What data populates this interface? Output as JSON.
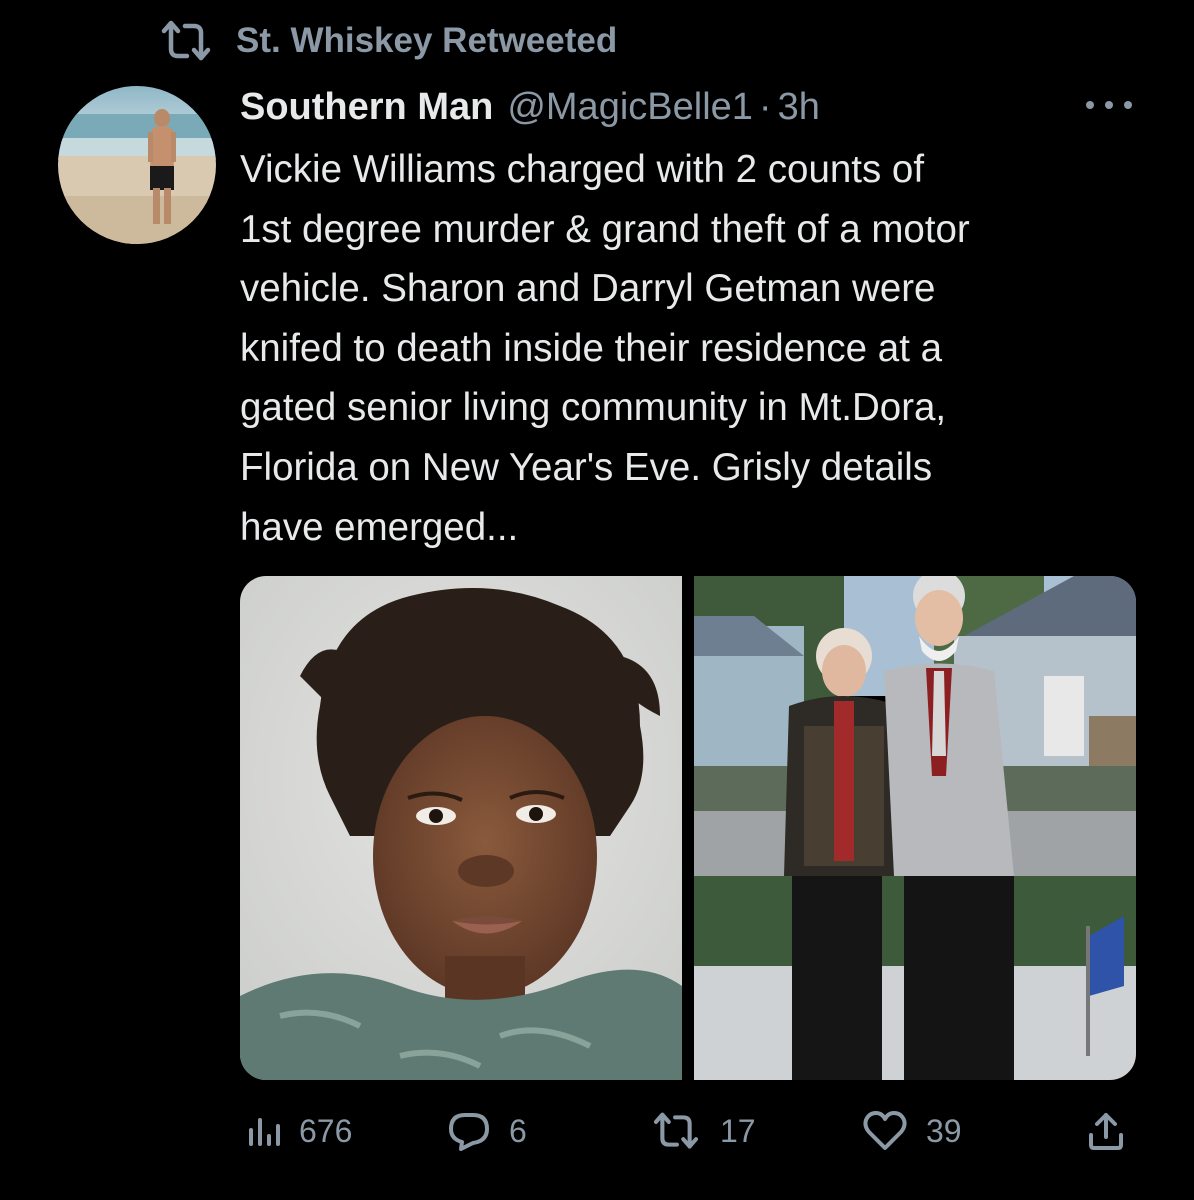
{
  "social_context": {
    "text": "St. Whiskey Retweeted",
    "icon": "retweet-icon"
  },
  "tweet": {
    "author": {
      "display_name": "Southern Man",
      "handle": "@MagicBelle1",
      "avatar": "avatar-photo"
    },
    "separator": "·",
    "time": "3h",
    "text_lines": [
      "Vickie Williams charged with 2 counts of",
      "1st degree murder & grand theft of a motor",
      "vehicle. Sharon and Darryl Getman were",
      "knifed to death inside their residence at a",
      "gated senior living community in Mt.Dora,",
      "Florida on New Year's Eve. Grisly details",
      "have emerged..."
    ],
    "media": [
      {
        "name": "mugshot-photo"
      },
      {
        "name": "couple-photo"
      }
    ],
    "actions": {
      "views": "676",
      "replies": "6",
      "retweets": "17",
      "likes": "39"
    }
  },
  "colors": {
    "background": "#000000",
    "primary_text": "#e7e9ea",
    "secondary_text": "#8b98a5"
  }
}
